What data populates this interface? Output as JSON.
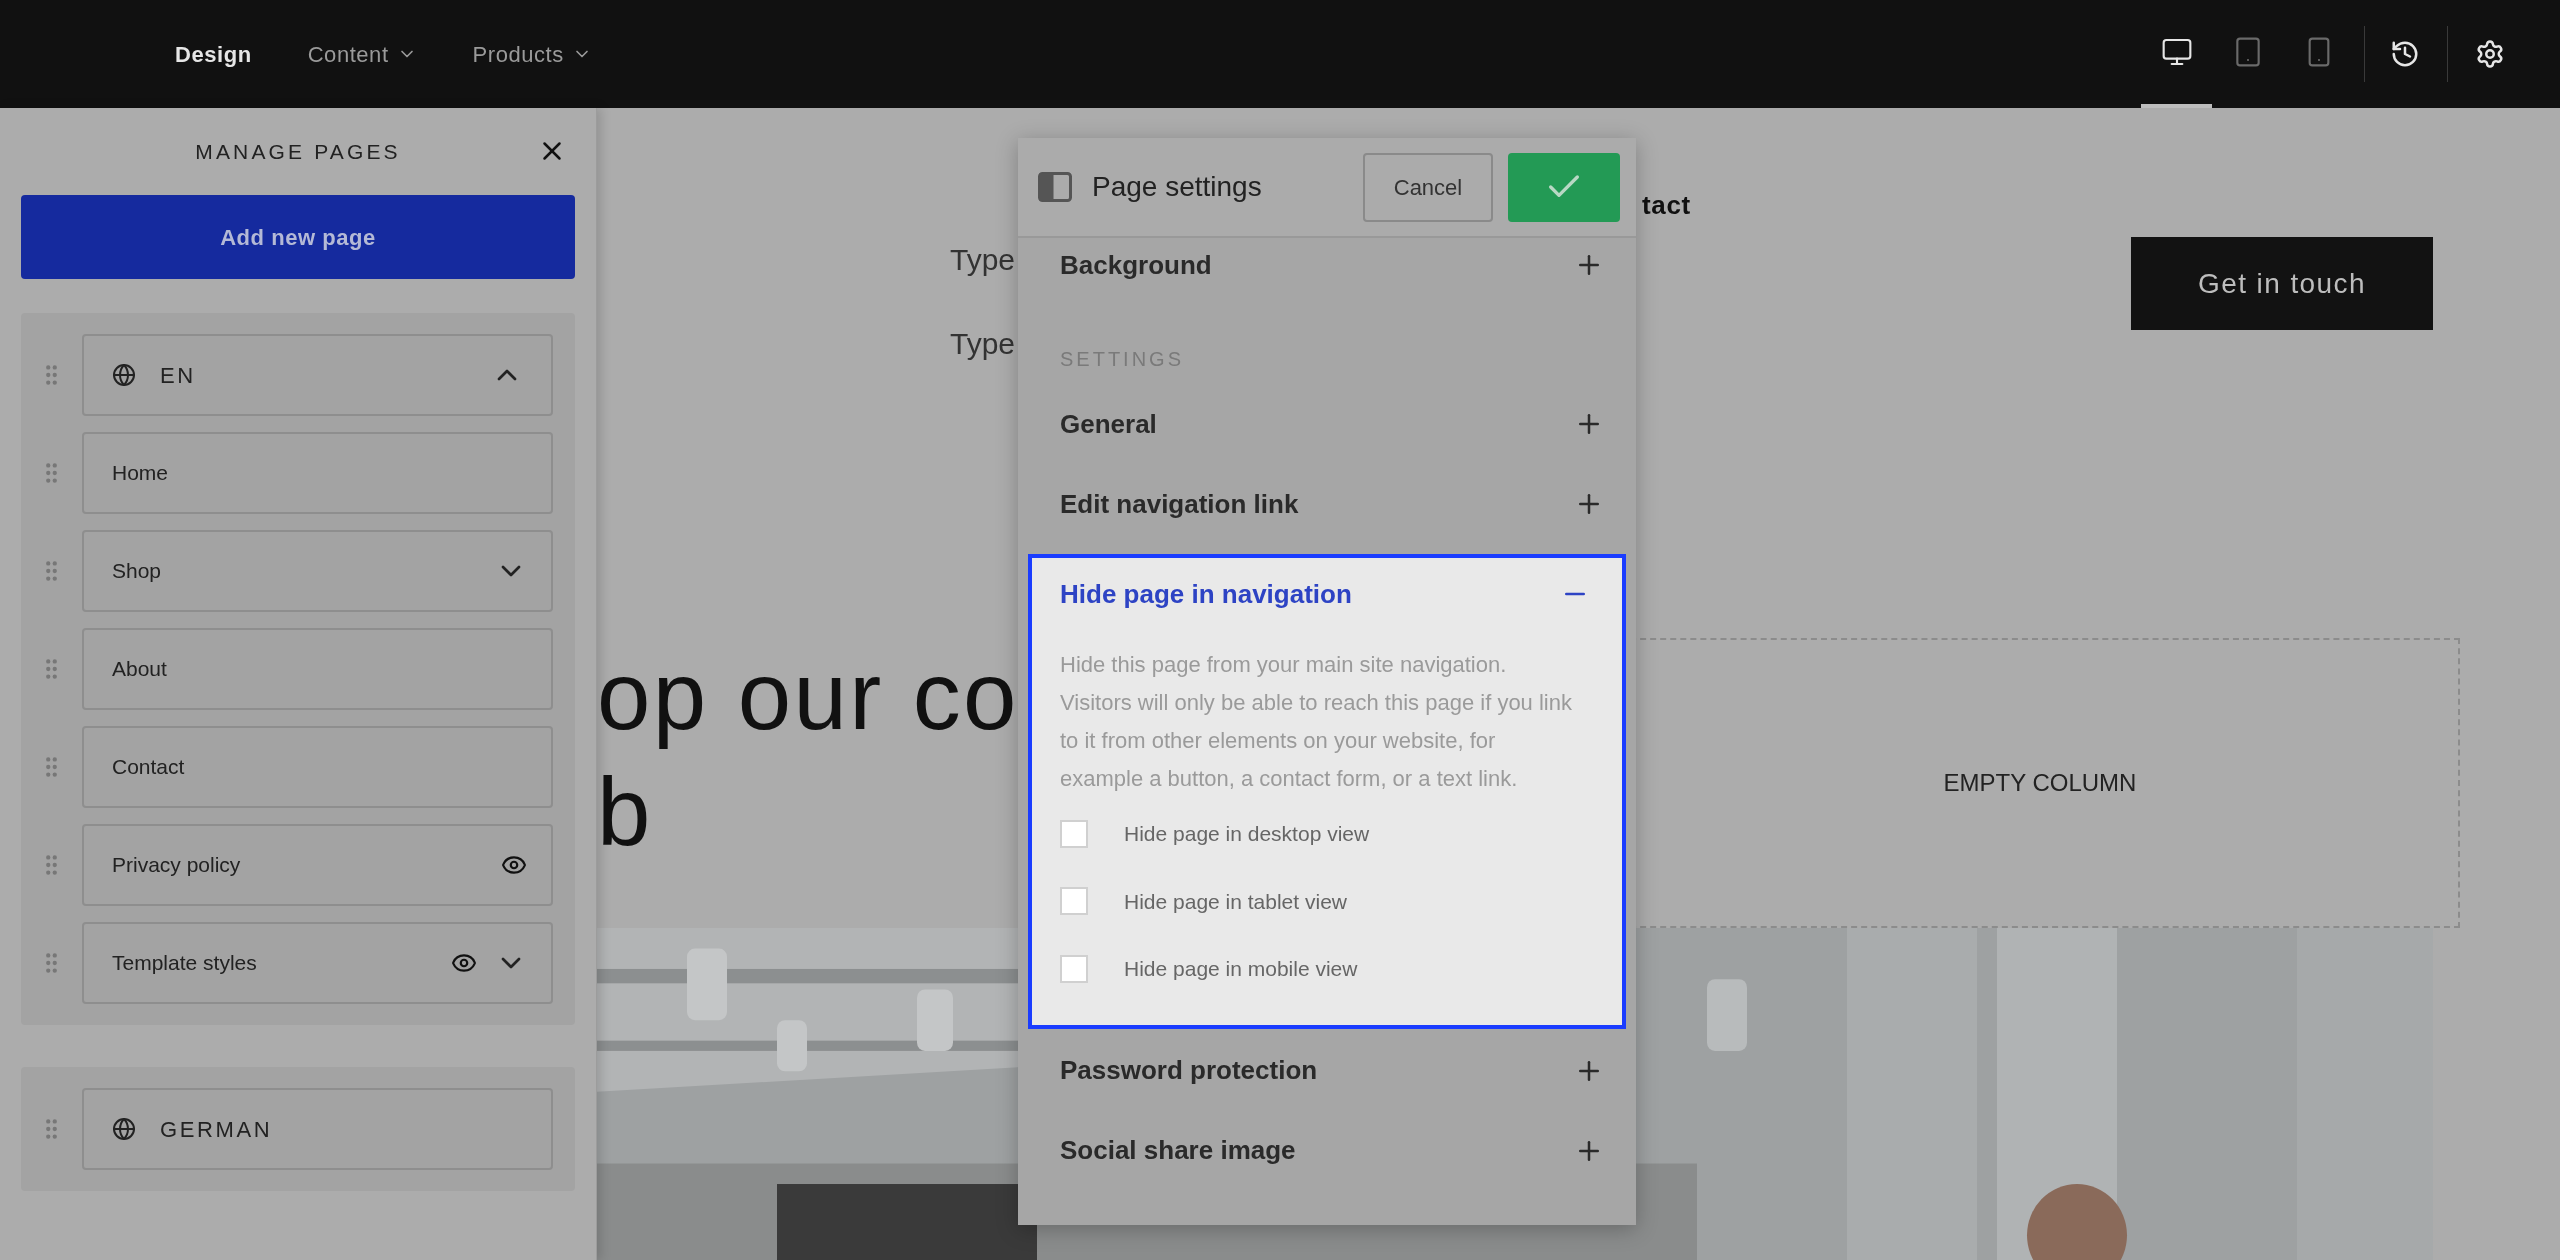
{
  "top_bar": {
    "nav": [
      {
        "label": "Design",
        "selected": true,
        "has_menu": false
      },
      {
        "label": "Content",
        "selected": false,
        "has_menu": true
      },
      {
        "label": "Products",
        "selected": false,
        "has_menu": true
      }
    ],
    "devices": [
      {
        "kind": "desktop",
        "selected": true
      },
      {
        "kind": "tablet",
        "selected": false
      },
      {
        "kind": "mobile",
        "selected": false
      }
    ]
  },
  "manage_pages": {
    "title": "MANAGE PAGES",
    "add_button": "Add new page",
    "groups": [
      {
        "label": "EN",
        "expanded": true,
        "pages": [
          {
            "label": "Home",
            "has_children": false,
            "eye": false
          },
          {
            "label": "Shop",
            "has_children": true,
            "eye": false
          },
          {
            "label": "About",
            "has_children": false,
            "eye": false
          },
          {
            "label": "Contact",
            "has_children": false,
            "eye": false
          },
          {
            "label": "Privacy policy",
            "has_children": false,
            "eye": true
          },
          {
            "label": "Template styles",
            "has_children": true,
            "eye": true
          }
        ]
      },
      {
        "label": "GERMAN"
      }
    ]
  },
  "background_page": {
    "nav_links": [
      "Type",
      "Type"
    ],
    "cut_link": "tact",
    "cta_button": "Get in touch",
    "heading_lines": [
      "op our co",
      "b"
    ],
    "empty_column": "EMPTY COLUMN",
    "photo": {
      "kind": "picture"
    }
  },
  "page_settings": {
    "title": "Page settings",
    "cancel": "Cancel",
    "sections": [
      {
        "kind": "section",
        "label": "Background",
        "expanded": false
      },
      {
        "kind": "heading",
        "label": "SETTINGS"
      },
      {
        "kind": "section",
        "label": "General",
        "expanded": false
      },
      {
        "kind": "section",
        "label": "Edit navigation link",
        "expanded": false
      },
      {
        "kind": "section",
        "label": "Hide page in navigation",
        "expanded": true,
        "description": "Hide this page from your main site navigation. Visitors will only be able to reach this page if you link to it from other elements on your website, for example a button, a contact form, or a text link.",
        "options": [
          {
            "label": "Hide page in desktop view",
            "checked": false
          },
          {
            "label": "Hide page in tablet view",
            "checked": false
          },
          {
            "label": "Hide page in mobile view",
            "checked": false
          }
        ]
      },
      {
        "kind": "section",
        "label": "Password protection",
        "expanded": false
      },
      {
        "kind": "section",
        "label": "Social share image",
        "expanded": false
      }
    ]
  }
}
